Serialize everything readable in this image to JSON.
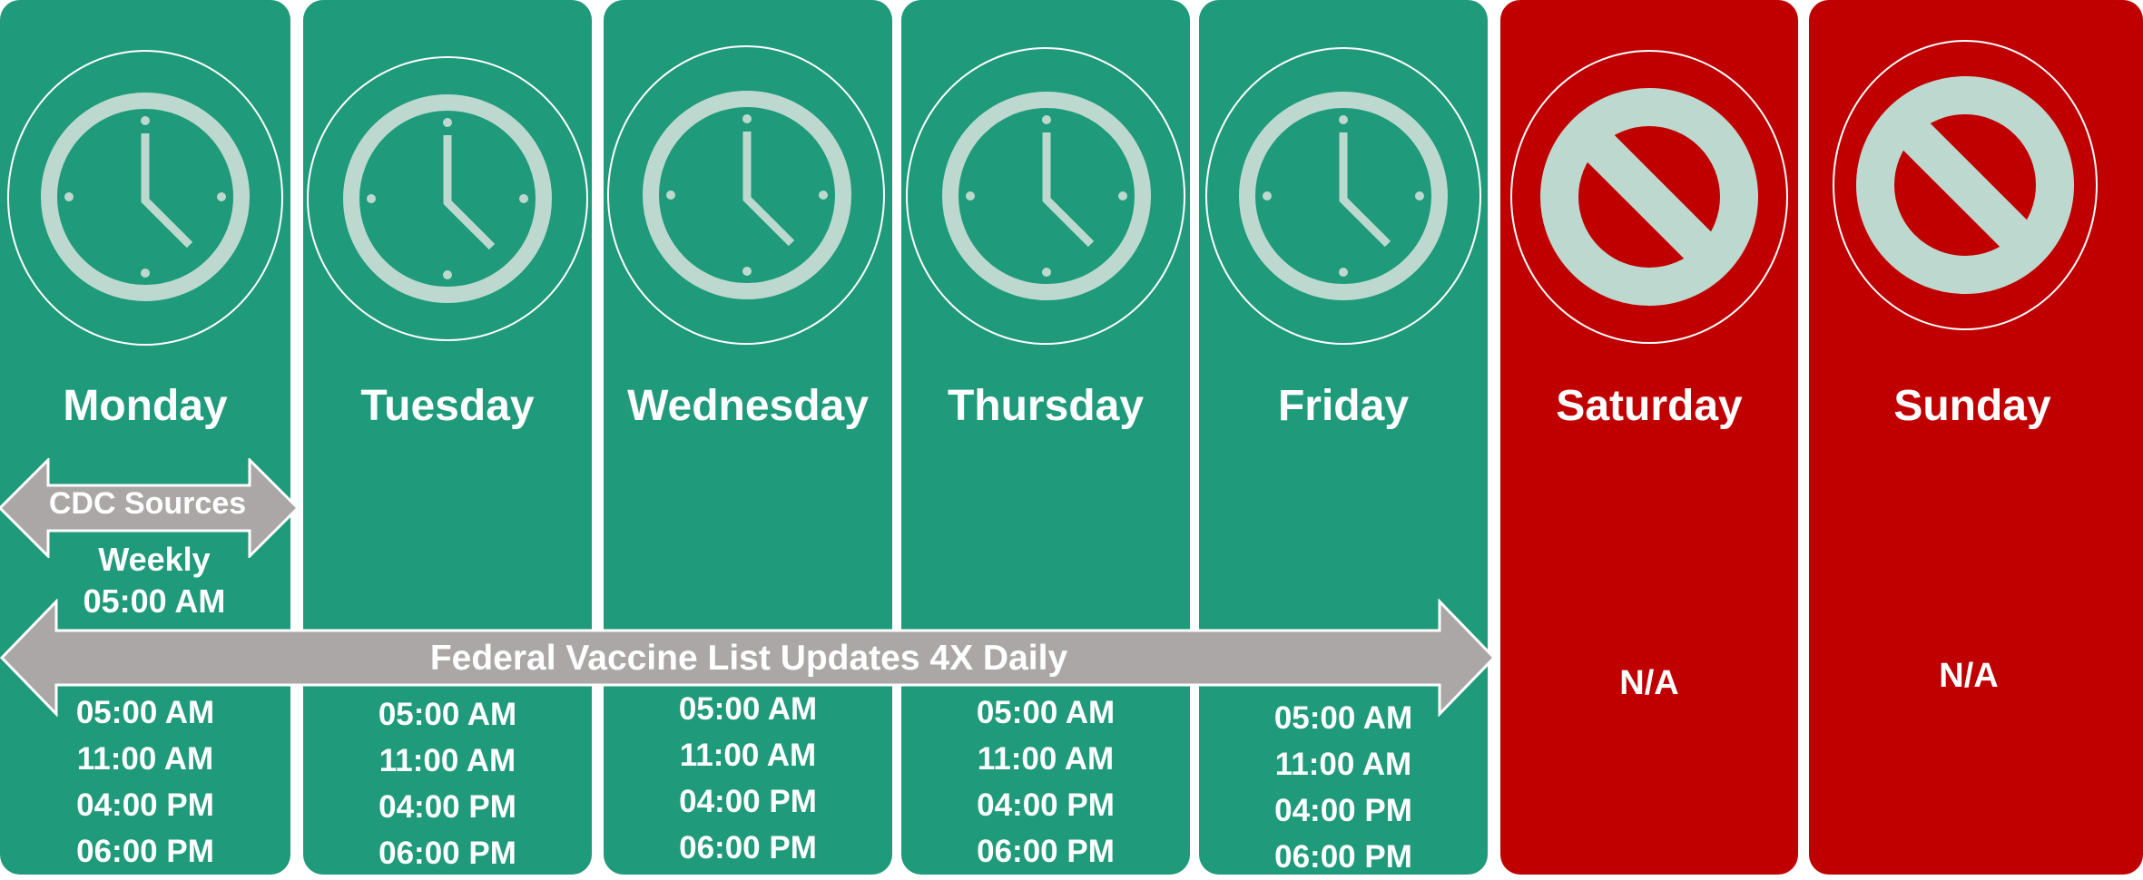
{
  "colors": {
    "weekday_bg": "#1f9a7a",
    "weekend_bg": "#c00000",
    "icon_fill": "#bdd9cf",
    "arrow_fill": "#aaa7a6",
    "text": "#ffffff"
  },
  "days": [
    {
      "name": "Monday",
      "icon": "clock-icon",
      "times": [
        "05:00 AM",
        "11:00 AM",
        "04:00 PM",
        "06:00 PM"
      ]
    },
    {
      "name": "Tuesday",
      "icon": "clock-icon",
      "times": [
        "05:00 AM",
        "11:00 AM",
        "04:00 PM",
        "06:00 PM"
      ]
    },
    {
      "name": "Wednesday",
      "icon": "clock-icon",
      "times": [
        "05:00 AM",
        "11:00 AM",
        "04:00 PM",
        "06:00 PM"
      ]
    },
    {
      "name": "Thursday",
      "icon": "clock-icon",
      "times": [
        "05:00 AM",
        "11:00 AM",
        "04:00 PM",
        "06:00 PM"
      ]
    },
    {
      "name": "Friday",
      "icon": "clock-icon",
      "times": [
        "05:00 AM",
        "11:00 AM",
        "04:00 PM",
        "06:00 PM"
      ]
    },
    {
      "name": "Saturday",
      "icon": "prohibited-icon",
      "status": "N/A"
    },
    {
      "name": "Sunday",
      "icon": "prohibited-icon",
      "status": "N/A"
    }
  ],
  "cdc": {
    "label": "CDC Sources",
    "frequency": "Weekly",
    "time": "05:00 AM"
  },
  "federal": {
    "label": "Federal Vaccine List Updates 4X Daily"
  }
}
